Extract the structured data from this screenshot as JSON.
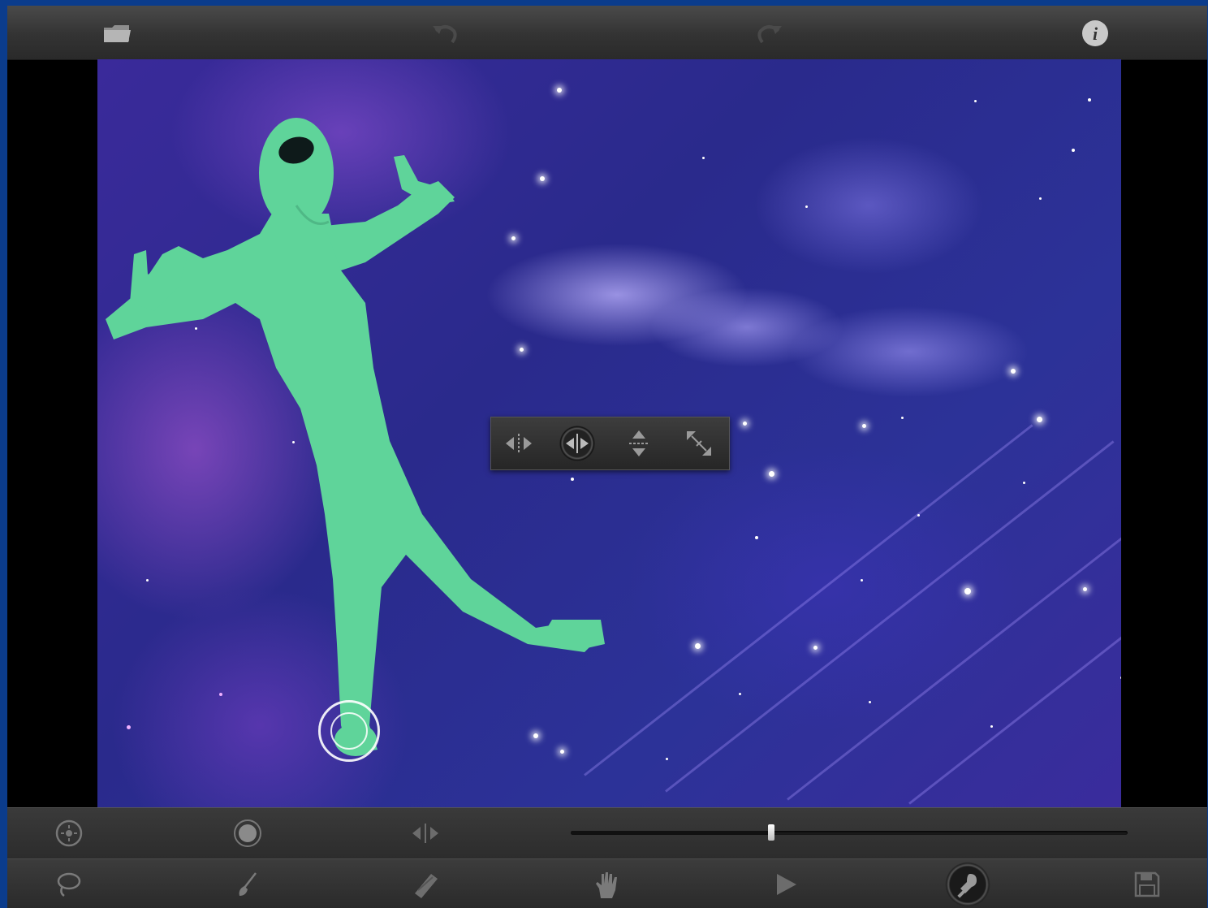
{
  "top_toolbar": {
    "open_icon": "folder-icon",
    "undo_icon": "undo-icon",
    "redo_icon": "redo-icon",
    "info_icon": "info-icon"
  },
  "move_popup": {
    "options": [
      {
        "name": "move-horizontal-icon",
        "active": false
      },
      {
        "name": "flip-horizontal-icon",
        "active": true
      },
      {
        "name": "move-vertical-icon",
        "active": false
      },
      {
        "name": "scale-icon",
        "active": false
      }
    ]
  },
  "adjust_toolbar": {
    "left_tools": [
      "target-icon",
      "brush-size-icon",
      "mirror-icon"
    ],
    "slider": {
      "value": 0.36
    }
  },
  "main_toolbar": {
    "tools": [
      "lasso-icon",
      "paint-brush-icon",
      "eraser-icon",
      "hand-icon",
      "play-icon",
      "stamp-icon",
      "save-icon"
    ],
    "active_tool": "stamp-icon"
  },
  "colors": {
    "background_border": "#0b3c8c",
    "figure": "#5fd49a",
    "toolbar": "#333333"
  }
}
